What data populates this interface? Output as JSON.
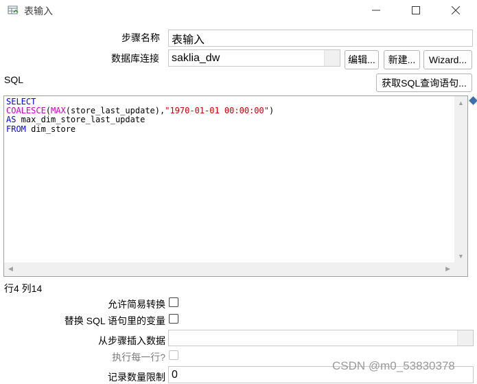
{
  "window": {
    "title": "表输入",
    "controls": {
      "minimize": "—",
      "maximize": "☐",
      "close": "✕"
    }
  },
  "form": {
    "step_name_label": "步骤名称",
    "step_name_value": "表输入",
    "connection_label": "数据库连接",
    "connection_value": "saklia_dw",
    "edit_button": "编辑...",
    "new_button": "新建...",
    "wizard_button": "Wizard...",
    "sql_label": "SQL",
    "get_sql_button": "获取SQL查询语句..."
  },
  "editor": {
    "lines": [
      [
        {
          "t": "SELECT",
          "c": "kw"
        }
      ],
      [
        {
          "t": "COALESCE",
          "c": "fn"
        },
        {
          "t": "(",
          "c": ""
        },
        {
          "t": "MAX",
          "c": "fn"
        },
        {
          "t": "(store_last_update),",
          "c": ""
        },
        {
          "t": "\"1970-01-01 00:00:00\"",
          "c": "str"
        },
        {
          "t": ")",
          "c": ""
        }
      ],
      [
        {
          "t": "AS",
          "c": "kw"
        },
        {
          "t": " max_dim_store_last_update",
          "c": ""
        }
      ],
      [
        {
          "t": "FROM",
          "c": "kw"
        },
        {
          "t": " dim_store",
          "c": ""
        }
      ]
    ],
    "position": "行4 列14"
  },
  "options": {
    "lazy_conversion_label": "允许简易转换",
    "replace_variables_label": "替换 SQL 语句里的变量",
    "insert_from_step_label": "从步骤插入数据",
    "execute_each_row_label": "执行每一行?",
    "limit_label": "记录数量限制",
    "limit_value": "0"
  },
  "watermark": "CSDN @m0_53830378",
  "colors": {
    "keyword": "#0000ff",
    "function": "#c800c8",
    "string": "#c80000"
  }
}
